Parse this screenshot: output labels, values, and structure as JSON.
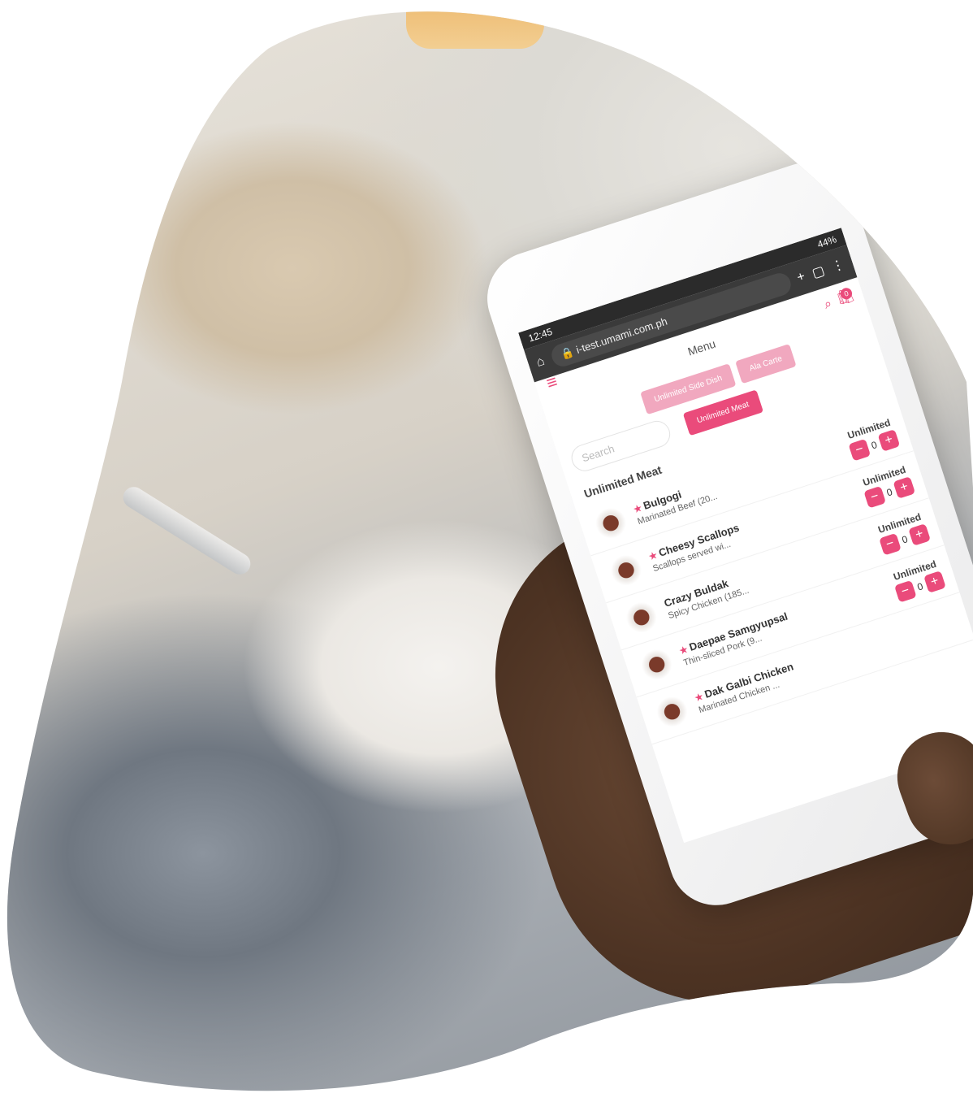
{
  "phone": {
    "status_time": "12:45",
    "status_right": "44%",
    "url": "i-test.umami.com.ph",
    "header_title": "Menu",
    "cart_count": "0",
    "tabs": [
      {
        "label": "Unlimited Meat",
        "active": true
      },
      {
        "label": "Unlimited Side Dish",
        "active": false
      },
      {
        "label": "Ala Carte",
        "active": false
      }
    ],
    "search_placeholder": "Search",
    "section_title": "Unlimited Meat",
    "items": [
      {
        "name": "Bulgogi",
        "desc": "Marinated Beef (20...",
        "starred": true,
        "label": "Unlimited",
        "qty": "0"
      },
      {
        "name": "Cheesy Scallops",
        "desc": "Scallops served wi...",
        "starred": true,
        "label": "Unlimited",
        "qty": "0"
      },
      {
        "name": "Crazy Buldak",
        "desc": "Spicy Chicken (185...",
        "starred": false,
        "label": "Unlimited",
        "qty": "0"
      },
      {
        "name": "Daepae Samgyupsal",
        "desc": "Thin-sliced Pork (9...",
        "starred": true,
        "label": "Unlimited",
        "qty": "0"
      },
      {
        "name": "Dak Galbi Chicken",
        "desc": "Marinated Chicken ...",
        "starred": true,
        "label": "",
        "qty": ""
      }
    ],
    "accent_color": "#ea4b7b"
  }
}
